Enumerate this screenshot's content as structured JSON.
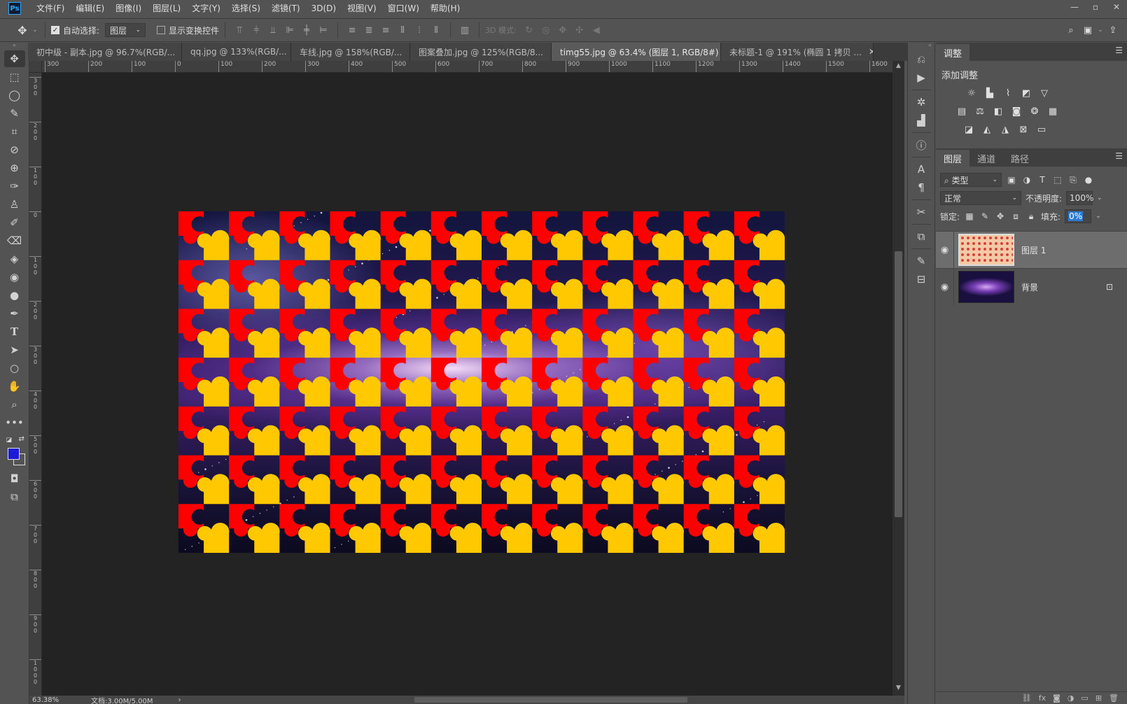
{
  "app": {
    "logo": "Ps"
  },
  "menu": [
    "文件(F)",
    "编辑(E)",
    "图像(I)",
    "图层(L)",
    "文字(Y)",
    "选择(S)",
    "滤镜(T)",
    "3D(D)",
    "视图(V)",
    "窗口(W)",
    "帮助(H)"
  ],
  "options": {
    "auto_select_label": "自动选择:",
    "auto_select_checked": true,
    "auto_select_target": "图层",
    "show_transform_label": "显示变换控件",
    "show_transform_checked": false,
    "mode_3d_label": "3D 模式:"
  },
  "tabs": [
    {
      "label": "初中级 - 副本.jpg @ 96.7%(RGB/...",
      "active": false
    },
    {
      "label": "qq.jpg @ 133%(RGB/...",
      "active": false
    },
    {
      "label": "车线.jpg @ 158%(RGB/...",
      "active": false
    },
    {
      "label": "图案叠加.jpg @ 125%(RGB/8...",
      "active": false
    },
    {
      "label": "timg55.jpg @ 63.4% (图层 1, RGB/8#) *",
      "active": true
    },
    {
      "label": "未标题-1 @ 191% (椭圆 1 拷贝 ...",
      "active": false
    }
  ],
  "ruler_h": [
    "300",
    "200",
    "100",
    "0",
    "100",
    "200",
    "300",
    "400",
    "500",
    "600",
    "700",
    "800",
    "900",
    "1000",
    "1100",
    "1200",
    "1300",
    "1400",
    "1500",
    "1600"
  ],
  "ruler_v": [
    "300",
    "200",
    "100",
    "0",
    "100",
    "200",
    "300",
    "400",
    "500",
    "600",
    "700",
    "800",
    "900",
    "1000"
  ],
  "status": {
    "zoom": "63.38%",
    "doc": "文档:3.00M/5.00M"
  },
  "colors": {
    "foreground": "#1b1bd8",
    "puzzle_red": "#ff0000",
    "puzzle_yellow": "#ffc800"
  },
  "adjustments": {
    "tab": "调整",
    "title": "添加调整"
  },
  "layers_panel": {
    "tabs": [
      "图层",
      "通道",
      "路径"
    ],
    "filter": "类型",
    "blend_mode": "正常",
    "opacity_label": "不透明度:",
    "opacity": "100%",
    "lock_label": "锁定:",
    "fill_label": "填充:",
    "fill": "0%",
    "layers": [
      {
        "name": "图层 1",
        "selected": true,
        "locked": false
      },
      {
        "name": "背景",
        "selected": false,
        "locked": true
      }
    ]
  }
}
